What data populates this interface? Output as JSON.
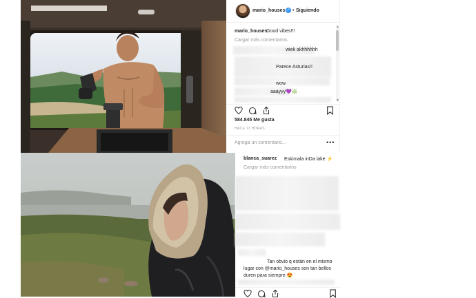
{
  "post1": {
    "username": "mario_houses",
    "separator": "•",
    "follow_status": "Siguiendo",
    "caption_user": "mario_houses",
    "caption_text": "Good vibes!!!",
    "load_more": "Cargar más comentarios",
    "comments": [
      {
        "text": "wiek akhhhhhh"
      },
      {
        "text": "Parece Asturias!!"
      },
      {
        "text": "wow"
      },
      {
        "text": "aaayyy💜❇️"
      }
    ],
    "likes": "584.845 Me gusta",
    "time_ago": "HACE 13 HORAS",
    "add_comment_placeholder": "Agrega un comentario...",
    "more_options": "•••",
    "icons": [
      "heart-icon",
      "comment-icon",
      "share-icon",
      "bookmark-icon"
    ]
  },
  "post2": {
    "caption_user": "blanca_suarez",
    "caption_text": "Eskimala inDa lake ⚡",
    "load_more": "Cargar más comentarios",
    "comment_lines": [
      "Tan obvio q están en el mismo",
      "lugar con @mario_houses son tan bellos",
      "duren para siempre 😍"
    ],
    "icons": [
      "heart-icon",
      "comment-icon",
      "share-icon",
      "bookmark-icon"
    ]
  },
  "colors": {
    "text": "#262626",
    "muted": "#999999",
    "verified": "#3897f0",
    "divider": "#efefef"
  }
}
